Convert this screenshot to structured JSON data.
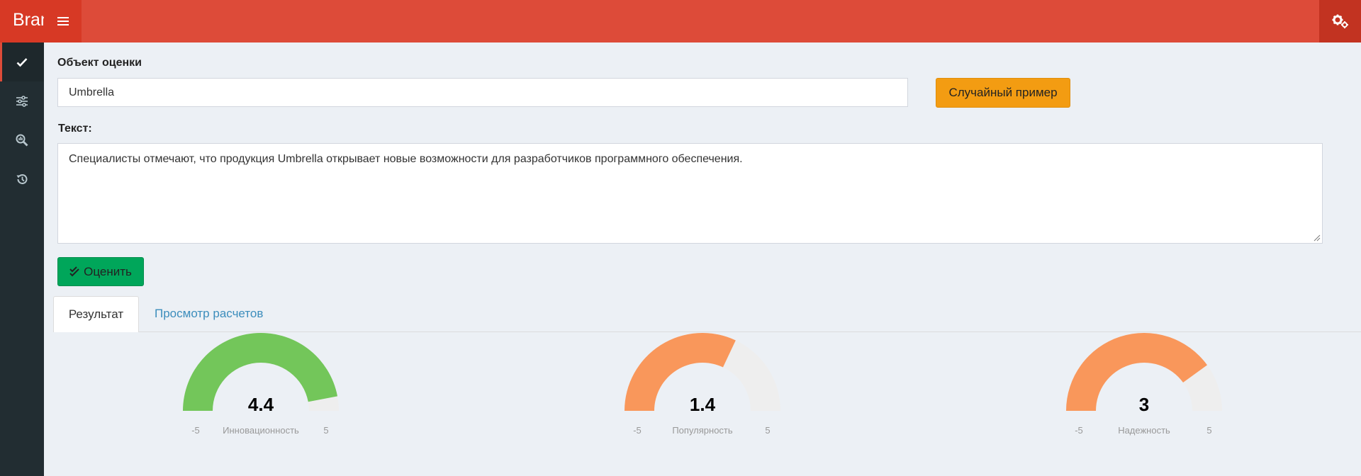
{
  "header": {
    "logo_text": "Brand Analytics"
  },
  "form": {
    "object_label": "Объект оценки",
    "object_value": "Umbrella",
    "random_button": "Случайный пример",
    "text_label": "Текст:",
    "text_value": "Специалисты отмечают, что продукция Umbrella открывает новые возможности для разработчиков программного обеспечения.",
    "evaluate_button": "Оценить"
  },
  "tabs": [
    {
      "label": "Результат",
      "active": true
    },
    {
      "label": "Просмотр расчетов",
      "active": false
    }
  ],
  "gauges": [
    {
      "value": 4.4,
      "value_text": "4.4",
      "label": "Инновационность",
      "min": -5,
      "max": 5,
      "min_text": "-5",
      "max_text": "5",
      "color": "#73c65a"
    },
    {
      "value": 1.4,
      "value_text": "1.4",
      "label": "Популярность",
      "min": -5,
      "max": 5,
      "min_text": "-5",
      "max_text": "5",
      "color": "#f9975b"
    },
    {
      "value": 3,
      "value_text": "3",
      "label": "Надежность",
      "min": -5,
      "max": 5,
      "min_text": "-5",
      "max_text": "5",
      "color": "#f9975b"
    }
  ],
  "colors": {
    "header": "#dd4b39",
    "sidebar": "#222d32",
    "gauge_track": "#eeeeee"
  }
}
